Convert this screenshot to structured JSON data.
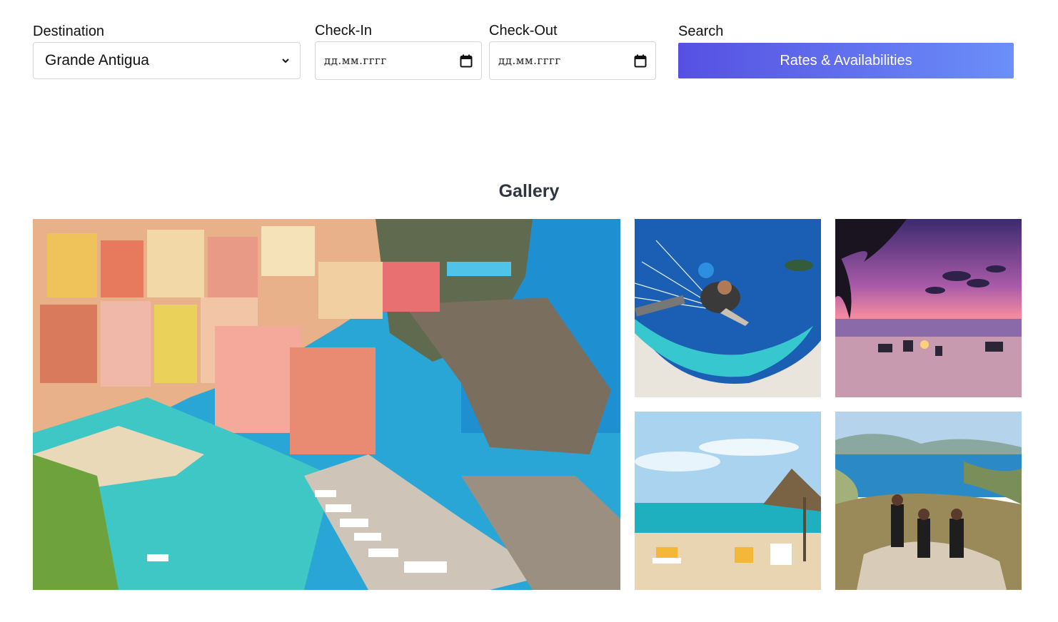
{
  "search_form": {
    "destination": {
      "label": "Destination",
      "selected": "Grande Antigua"
    },
    "check_in": {
      "label": "Check-In",
      "placeholder": "дд.мм.гггг"
    },
    "check_out": {
      "label": "Check-Out",
      "placeholder": "дд.мм.гггг"
    },
    "search": {
      "label": "Search",
      "button_label": "Rates & Availabilities"
    }
  },
  "gallery": {
    "title": "Gallery",
    "images": [
      {
        "subject": "colorful coastal village harbor"
      },
      {
        "subject": "paragliders over turquoise lagoon"
      },
      {
        "subject": "beach at purple sunset with palm"
      },
      {
        "subject": "beach with straw umbrella and lounge chairs"
      },
      {
        "subject": "hikers on a hilltop above a bay"
      }
    ]
  },
  "colors": {
    "button_gradient_start": "#5650e2",
    "button_gradient_end": "#6b8ff9",
    "title_color": "#2f3441"
  }
}
